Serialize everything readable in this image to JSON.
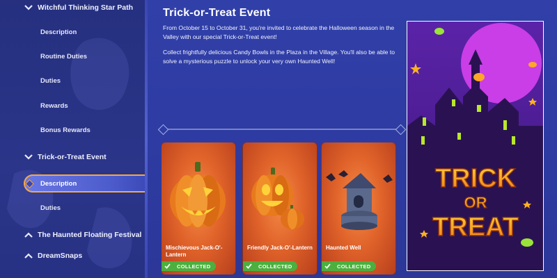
{
  "sidebar": {
    "sections": [
      {
        "label": "Witchful Thinking Star Path",
        "expanded": true
      },
      {
        "label": "Trick-or-Treat Event",
        "expanded": true
      },
      {
        "label": "The Haunted Floating Festival",
        "expanded": false
      },
      {
        "label": "DreamSnaps",
        "expanded": false
      }
    ],
    "witchful_items": [
      "Description",
      "Routine Duties",
      "Duties",
      "Rewards",
      "Bonus Rewards"
    ],
    "trick_items": [
      "Description",
      "Duties"
    ],
    "active_item": "Description"
  },
  "main": {
    "title": "Trick-or-Treat Event",
    "paragraph1": "From October 15 to October 31, you're invited to celebrate the Halloween season in the Valley with our special Trick-or-Treat event!",
    "paragraph2": "Collect frightfully delicious Candy Bowls in the Plaza in the Village. You'll also be able to solve a mysterious puzzle to unlock your very own Haunted Well!",
    "cards": [
      {
        "name": "Mischievous Jack-O'-Lantern",
        "status": "COLLECTED"
      },
      {
        "name": "Friendly Jack-O'-Lantern",
        "status": "COLLECTED"
      },
      {
        "name": "Haunted Well",
        "status": "COLLECTED"
      }
    ]
  },
  "poster": {
    "line1": "TRICK",
    "line2": "OR",
    "line3": "TREAT"
  },
  "colors": {
    "sidebar_bg": "#2b3589",
    "main_bg": "#2f3a9e",
    "card_orange": "#e0632a",
    "collected_green": "#4caf3e",
    "active_border": "#f2a94a",
    "poster_purple": "#7a2bc9"
  },
  "icons": {
    "expanded": "chevron-down-icon",
    "collapsed": "chevron-up-icon",
    "collected": "checkmark-icon"
  }
}
